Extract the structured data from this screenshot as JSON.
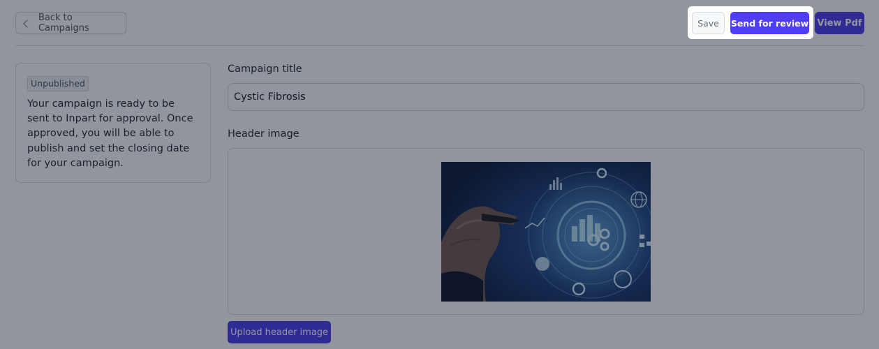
{
  "header": {
    "back_label": "Back to Campaigns",
    "save_label": "Save",
    "send_review_label": "Send for review",
    "view_pdf_label": "View Pdf"
  },
  "status_card": {
    "badge": "Unpublished",
    "message": "Your campaign is ready to be sent to Inpart for approval. Once approved, you will be able to publish and set the closing date for your campaign."
  },
  "form": {
    "title_label": "Campaign title",
    "title_value": "Cystic Fibrosis",
    "header_image_label": "Header image",
    "upload_label": "Upload header image"
  },
  "colors": {
    "accent": "#4f3ef5",
    "overlay": "rgba(17,24,39,0.46)"
  },
  "icons": {
    "back": "chevron-left-icon",
    "header_image": "business-analytics-illustration"
  }
}
